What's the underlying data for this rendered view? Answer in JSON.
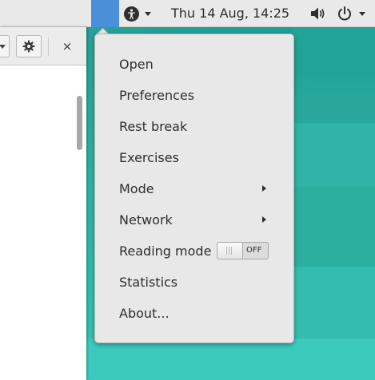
{
  "topbar": {
    "clock": "Thu 14 Aug, 14:25",
    "accessibility_icon": "accessibility-icon",
    "volume_icon": "volume-icon",
    "power_icon": "power-icon",
    "activity_color": "#4a90d9"
  },
  "app_window": {
    "close_glyph": "×",
    "gear_icon": "gear-icon"
  },
  "menu": {
    "items": [
      {
        "label": "Open"
      },
      {
        "label": "Preferences"
      },
      {
        "label": "Rest break"
      },
      {
        "label": "Exercises"
      },
      {
        "label": "Mode",
        "submenu": true
      },
      {
        "label": "Network",
        "submenu": true
      },
      {
        "label": "Reading mode",
        "toggle": true,
        "toggle_state": "OFF"
      },
      {
        "label": "Statistics"
      },
      {
        "label": "About..."
      }
    ]
  },
  "colors": {
    "desktop": "#2bb0a3",
    "menu_bg": "#e8e8e8",
    "topbar_bg": "#e9e9e9"
  }
}
